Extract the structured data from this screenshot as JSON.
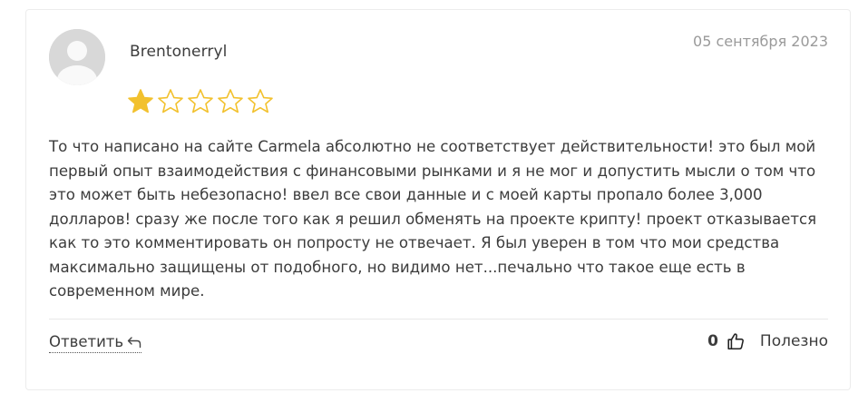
{
  "review": {
    "author": "Brentonerryl",
    "date": "05 сентября 2023",
    "rating": 1,
    "rating_max": 5,
    "text": "То что написано на сайте Carmela абсолютно не соответствует действительности! это был мой первый опыт взаимодействия с финансовыми рынками и я не мог и допустить мысли о том что это может быть небезопасно! ввел все свои данные и с моей карты пропало более 3,000 долларов! сразу же после того как я решил обменять на проекте крипту! проект отказывается как то это комментировать он попросту не отвечает. Я был уверен в том что мои средства максимально защищены от подобного, но видимо нет...печально что такое еще есть в современном мире."
  },
  "actions": {
    "reply_label": "Ответить",
    "helpful_count": "0",
    "helpful_label": "Полезно"
  },
  "colors": {
    "star_filled": "#f2c12e",
    "star_outline": "#f2c12e",
    "date_text": "#9a9a9a",
    "body_text": "#3c3c3c"
  },
  "icons": {
    "avatar": "user-silhouette-icon",
    "reply": "reply-arrow-icon",
    "helpful": "thumbs-up-icon",
    "rating": "star-icon"
  }
}
